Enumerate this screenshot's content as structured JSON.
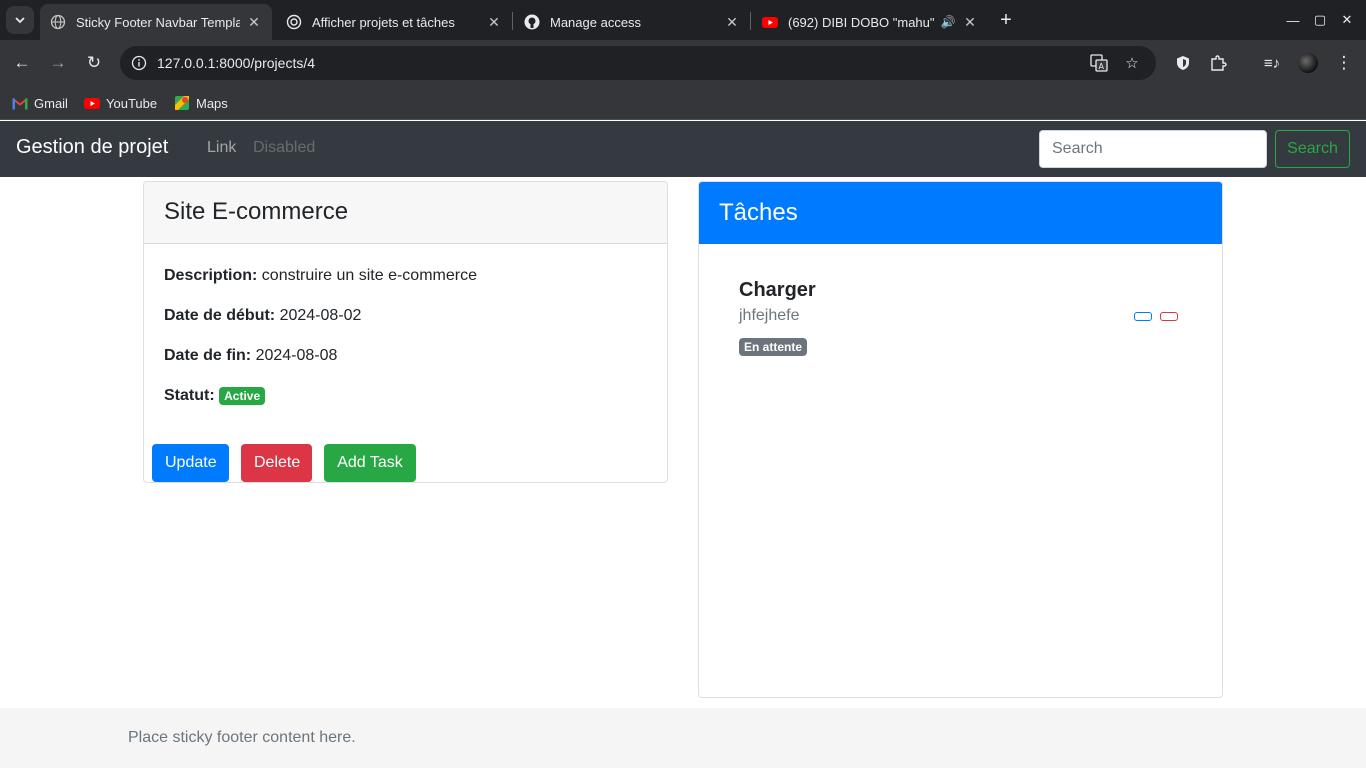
{
  "browser": {
    "tabs": [
      {
        "title": "Sticky Footer Navbar Templa",
        "icon": "globe-icon",
        "active": true
      },
      {
        "title": "Afficher projets et tâches",
        "icon": "chatgpt-icon",
        "active": false
      },
      {
        "title": "Manage access",
        "icon": "github-icon",
        "active": false
      },
      {
        "title": "(692) DIBI DOBO \"mahu\"",
        "icon": "youtube-icon",
        "active": false
      }
    ],
    "url": "127.0.0.1:8000/projects/4",
    "bookmarks": [
      {
        "label": "Gmail",
        "icon": "gmail-icon"
      },
      {
        "label": "YouTube",
        "icon": "youtube-icon"
      },
      {
        "label": "Maps",
        "icon": "maps-icon"
      }
    ]
  },
  "navbar": {
    "brand": "Gestion de projet",
    "link": "Link",
    "disabled": "Disabled",
    "search_placeholder": "Search",
    "search_button": "Search"
  },
  "project": {
    "title": "Site E-commerce",
    "description_label": "Description:",
    "description": "construire un site e-commerce",
    "start_label": "Date de début:",
    "start_date": "2024-08-02",
    "end_label": "Date de fin:",
    "end_date": "2024-08-08",
    "status_label": "Statut:",
    "status": "Active",
    "buttons": {
      "update": "Update",
      "delete": "Delete",
      "add_task": "Add Task"
    }
  },
  "tasks": {
    "title": "Tâches",
    "items": [
      {
        "name": "Charger",
        "description": "jhfejhefe",
        "status": "En attente"
      }
    ]
  },
  "footer": {
    "text": "Place sticky footer content here."
  },
  "colors": {
    "primary": "#007bff",
    "danger": "#dc3545",
    "success": "#28a745",
    "secondary": "#6c757d",
    "navbar": "#343a40"
  }
}
